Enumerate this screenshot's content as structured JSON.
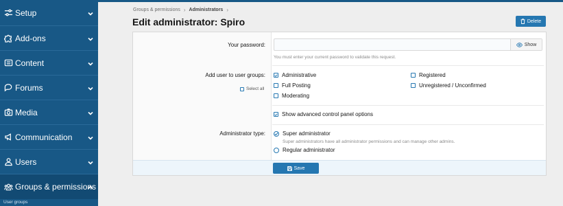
{
  "sidebar": {
    "items": [
      {
        "label": "Setup"
      },
      {
        "label": "Add-ons"
      },
      {
        "label": "Content"
      },
      {
        "label": "Forums"
      },
      {
        "label": "Media"
      },
      {
        "label": "Communication"
      },
      {
        "label": "Users"
      },
      {
        "label": "Groups & permissions"
      }
    ],
    "sub_item": "User groups"
  },
  "breadcrumb": {
    "parent": "Groups & permissions",
    "current": "Administrators"
  },
  "page": {
    "title": "Edit administrator: Spiro",
    "delete_label": "Delete"
  },
  "form": {
    "password_label": "Your password:",
    "show_label": "Show",
    "password_hint": "You must enter your current password to validate this request.",
    "groups_label": "Add user to user groups:",
    "select_all": "Select all",
    "groups": [
      {
        "label": "Administrative",
        "checked": true
      },
      {
        "label": "Full Posting",
        "checked": false
      },
      {
        "label": "Moderating",
        "checked": false
      },
      {
        "label": "Registered",
        "checked": false
      },
      {
        "label": "Unregistered / Unconfirmed",
        "checked": false
      }
    ],
    "advanced_label": "Show advanced control panel options",
    "advanced_checked": true,
    "admin_type_label": "Administrator type:",
    "super_admin_label": "Super administrator",
    "super_admin_hint": "Super administrators have all administrator permissions and can manage other admins.",
    "regular_admin_label": "Regular administrator",
    "selected_type": "super",
    "save_label": "Save"
  },
  "colors": {
    "sidebar": "#185886",
    "accent": "#2577b1"
  }
}
